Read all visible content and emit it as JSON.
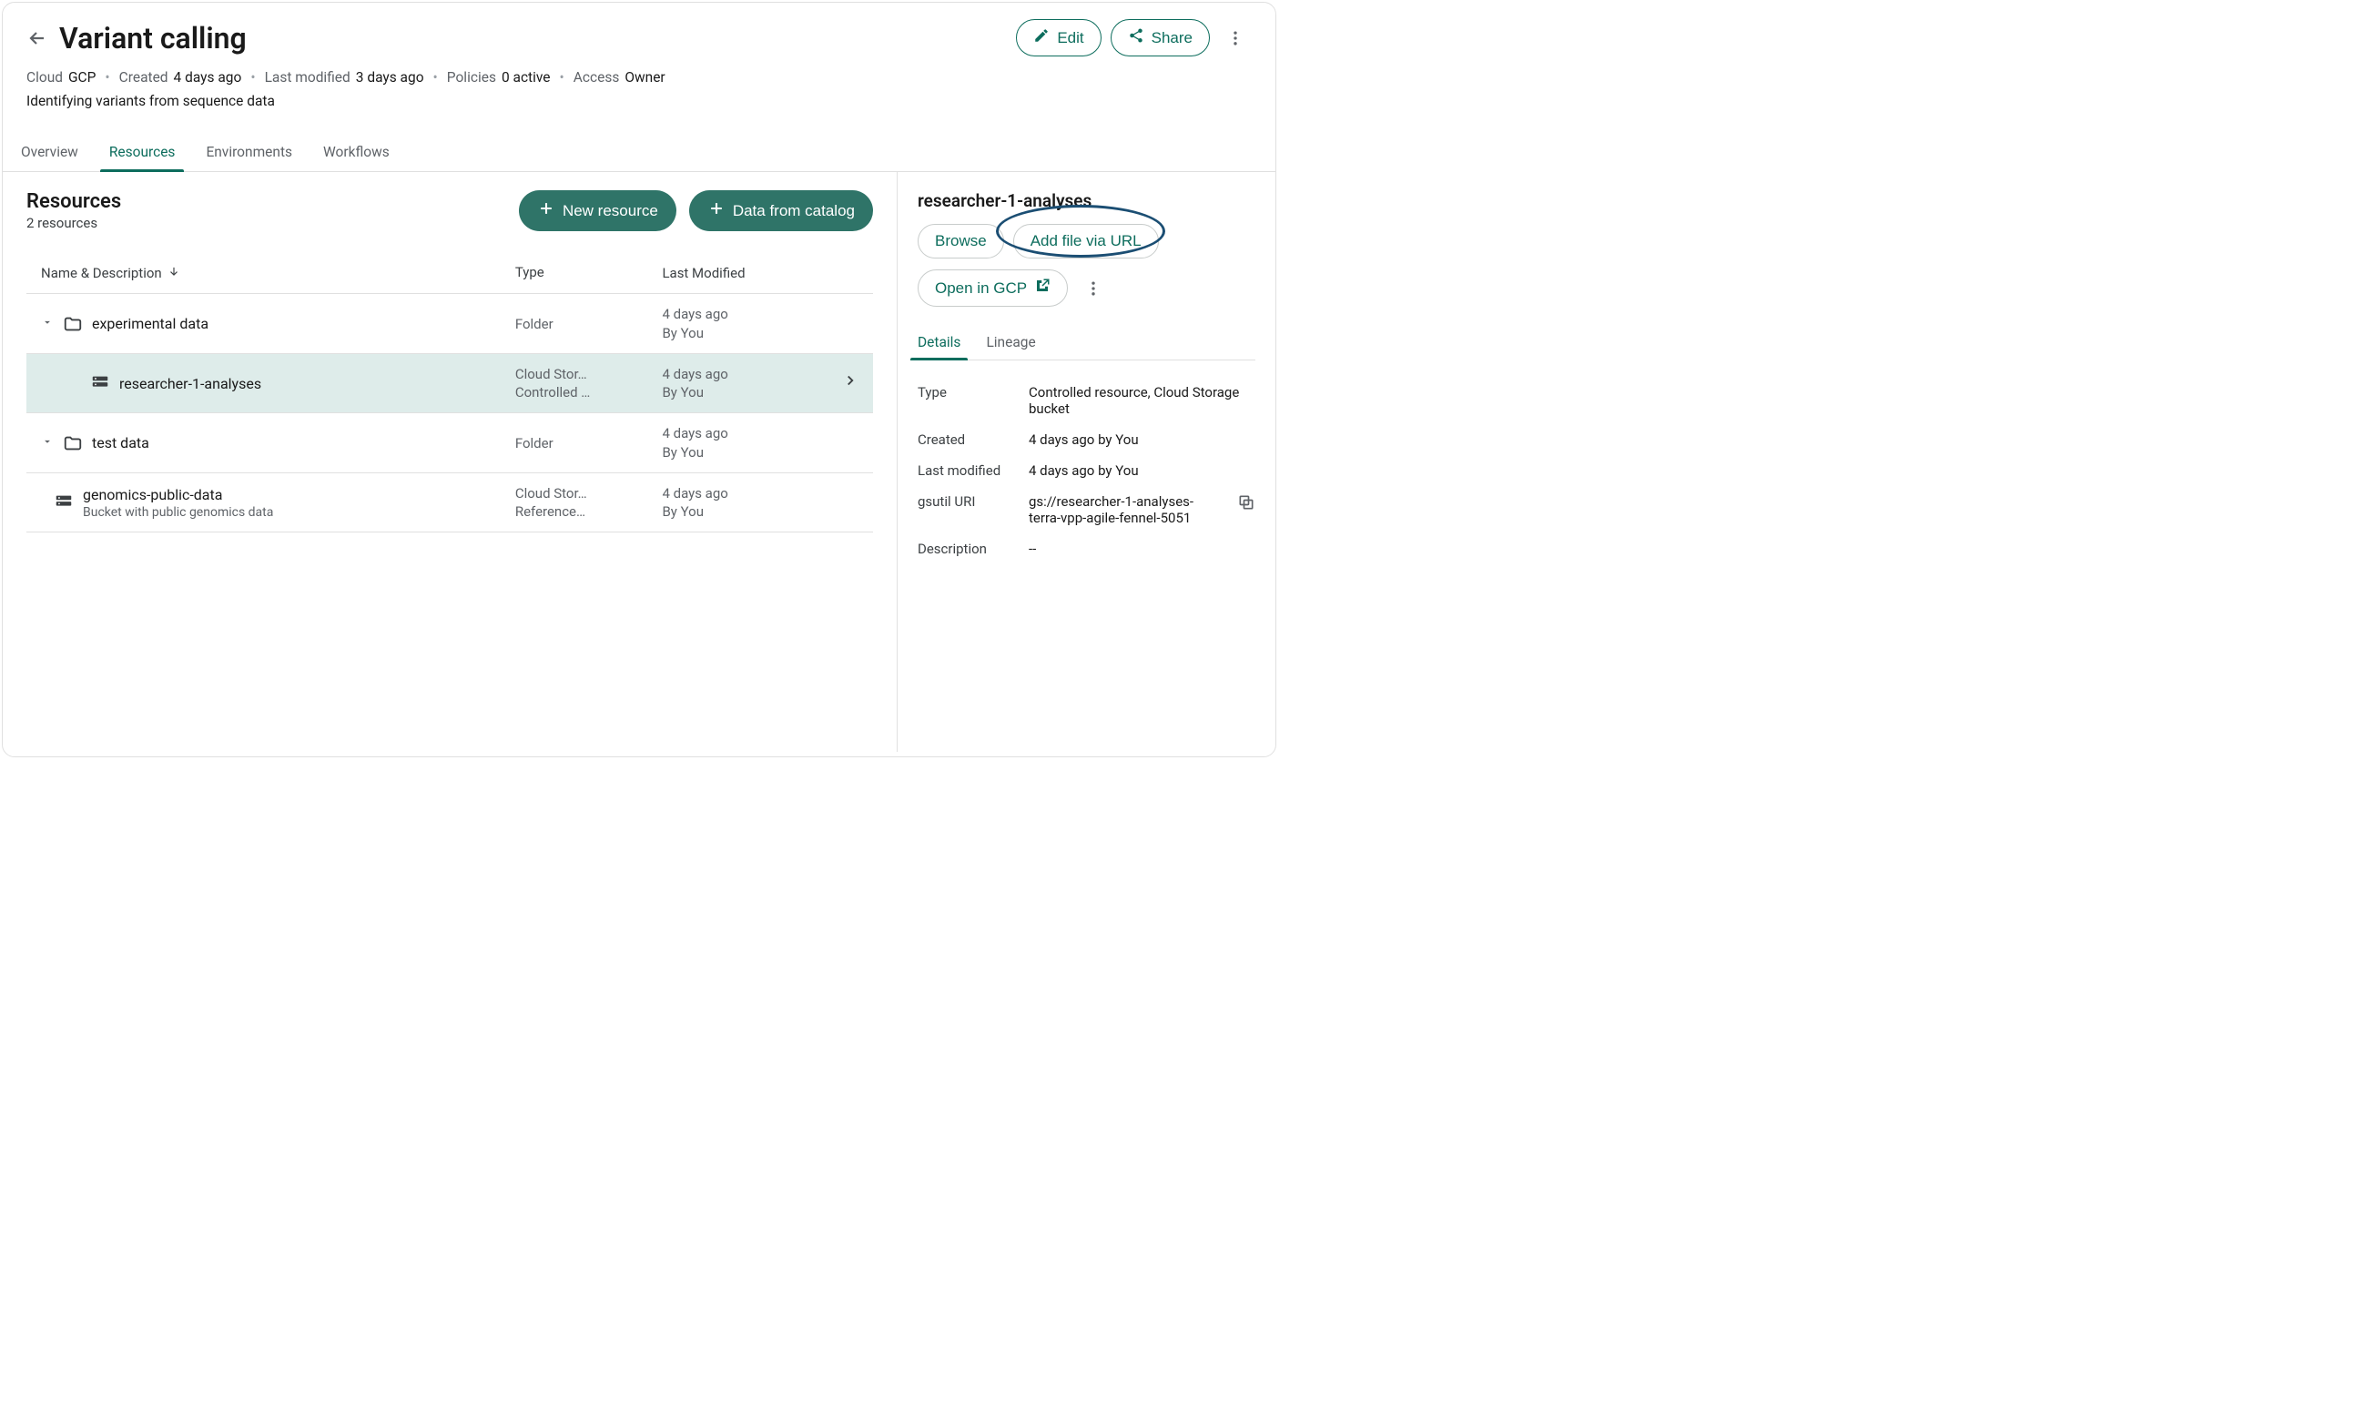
{
  "header": {
    "title": "Variant calling",
    "edit_label": "Edit",
    "share_label": "Share"
  },
  "meta": {
    "cloud_label": "Cloud",
    "cloud_value": "GCP",
    "created_label": "Created",
    "created_value": "4 days ago",
    "modified_label": "Last modified",
    "modified_value": "3 days ago",
    "policies_label": "Policies",
    "policies_value": "0 active",
    "access_label": "Access",
    "access_value": "Owner",
    "description": "Identifying variants from sequence data"
  },
  "tabs": {
    "overview": "Overview",
    "resources": "Resources",
    "environments": "Environments",
    "workflows": "Workflows"
  },
  "resources": {
    "title": "Resources",
    "count": "2 resources",
    "new_resource_label": "New resource",
    "data_catalog_label": "Data from catalog",
    "columns": {
      "name": "Name & Description",
      "type": "Type",
      "modified": "Last Modified"
    },
    "rows": [
      {
        "name": "experimental data",
        "type": "Folder",
        "modified": "4 days ago",
        "by": "By You"
      },
      {
        "name": "researcher-1-analyses",
        "type1": "Cloud Stor…",
        "type2": "Controlled …",
        "modified": "4 days ago",
        "by": "By You"
      },
      {
        "name": "test data",
        "type": "Folder",
        "modified": "4 days ago",
        "by": "By You"
      },
      {
        "name": "genomics-public-data",
        "desc": "Bucket with public genomics data",
        "type1": "Cloud Stor…",
        "type2": "Reference…",
        "modified": "4 days ago",
        "by": "By You"
      }
    ]
  },
  "detail": {
    "title": "researcher-1-analyses",
    "browse_label": "Browse",
    "add_file_label": "Add file via URL",
    "open_gcp_label": "Open in GCP",
    "tabs": {
      "details": "Details",
      "lineage": "Lineage"
    },
    "kv": {
      "type_k": "Type",
      "type_v": "Controlled resource, Cloud Storage bucket",
      "created_k": "Created",
      "created_v": "4 days ago by You",
      "modified_k": "Last modified",
      "modified_v": "4 days ago by You",
      "gsutil_k": "gsutil URI",
      "gsutil_v": "gs://researcher-1-analyses-terra-vpp-agile-fennel-5051",
      "desc_k": "Description",
      "desc_v": "--"
    }
  }
}
